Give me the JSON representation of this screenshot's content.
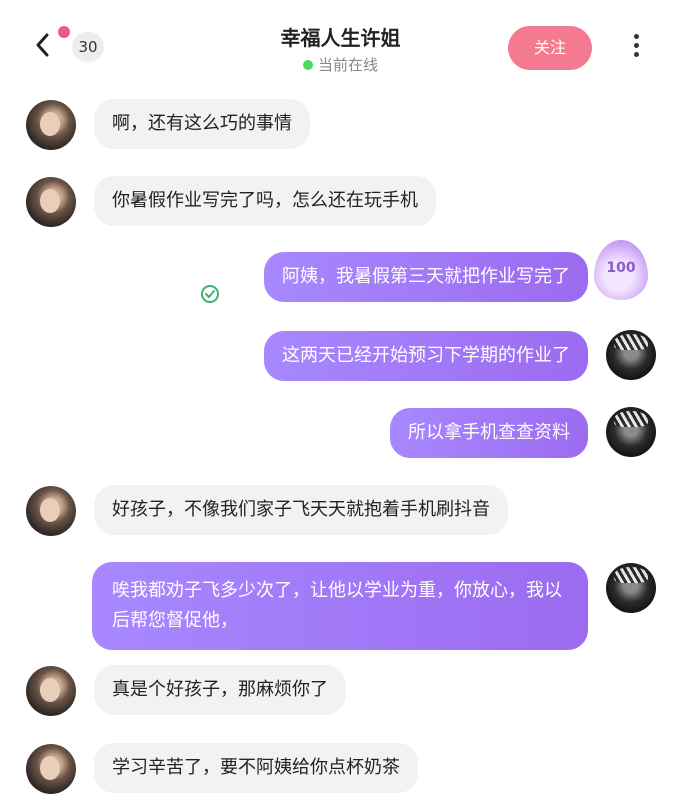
{
  "header": {
    "unread_count": "30",
    "title": "幸福人生许姐",
    "status": "当前在线",
    "follow_label": "关注"
  },
  "messages": [
    {
      "side": "in",
      "text": "啊，还有这么巧的事情"
    },
    {
      "side": "in",
      "text": "你暑假作业写完了吗，怎么还在玩手机"
    },
    {
      "side": "out",
      "text": "阿姨，我暑假第三天就把作业写完了"
    },
    {
      "side": "out",
      "text": "这两天已经开始预习下学期的作业了"
    },
    {
      "side": "out",
      "text": "所以拿手机查查资料"
    },
    {
      "side": "in",
      "text": "好孩子，不像我们家子飞天天就抱着手机刷抖音"
    },
    {
      "side": "out",
      "text": "唉我都劝子飞多少次了，让他以学业为重，你放心，我以后帮您督促他，"
    },
    {
      "side": "in",
      "text": "真是个好孩子，那麻烦你了"
    },
    {
      "side": "in",
      "text": "学习辛苦了，要不阿姨给你点杯奶茶"
    }
  ],
  "streak_badge": "100",
  "icons": {
    "back": "chevron-left-icon",
    "more": "more-vertical-icon",
    "read": "check-circle-icon",
    "streak": "flame-badge-icon"
  },
  "colors": {
    "accent": "#f37a8f",
    "notif_dot": "#f25a7d",
    "online": "#4cd964",
    "bubble_out_start": "#a888ff",
    "bubble_out_end": "#9b6bf0",
    "bubble_in": "#f2f2f5"
  }
}
